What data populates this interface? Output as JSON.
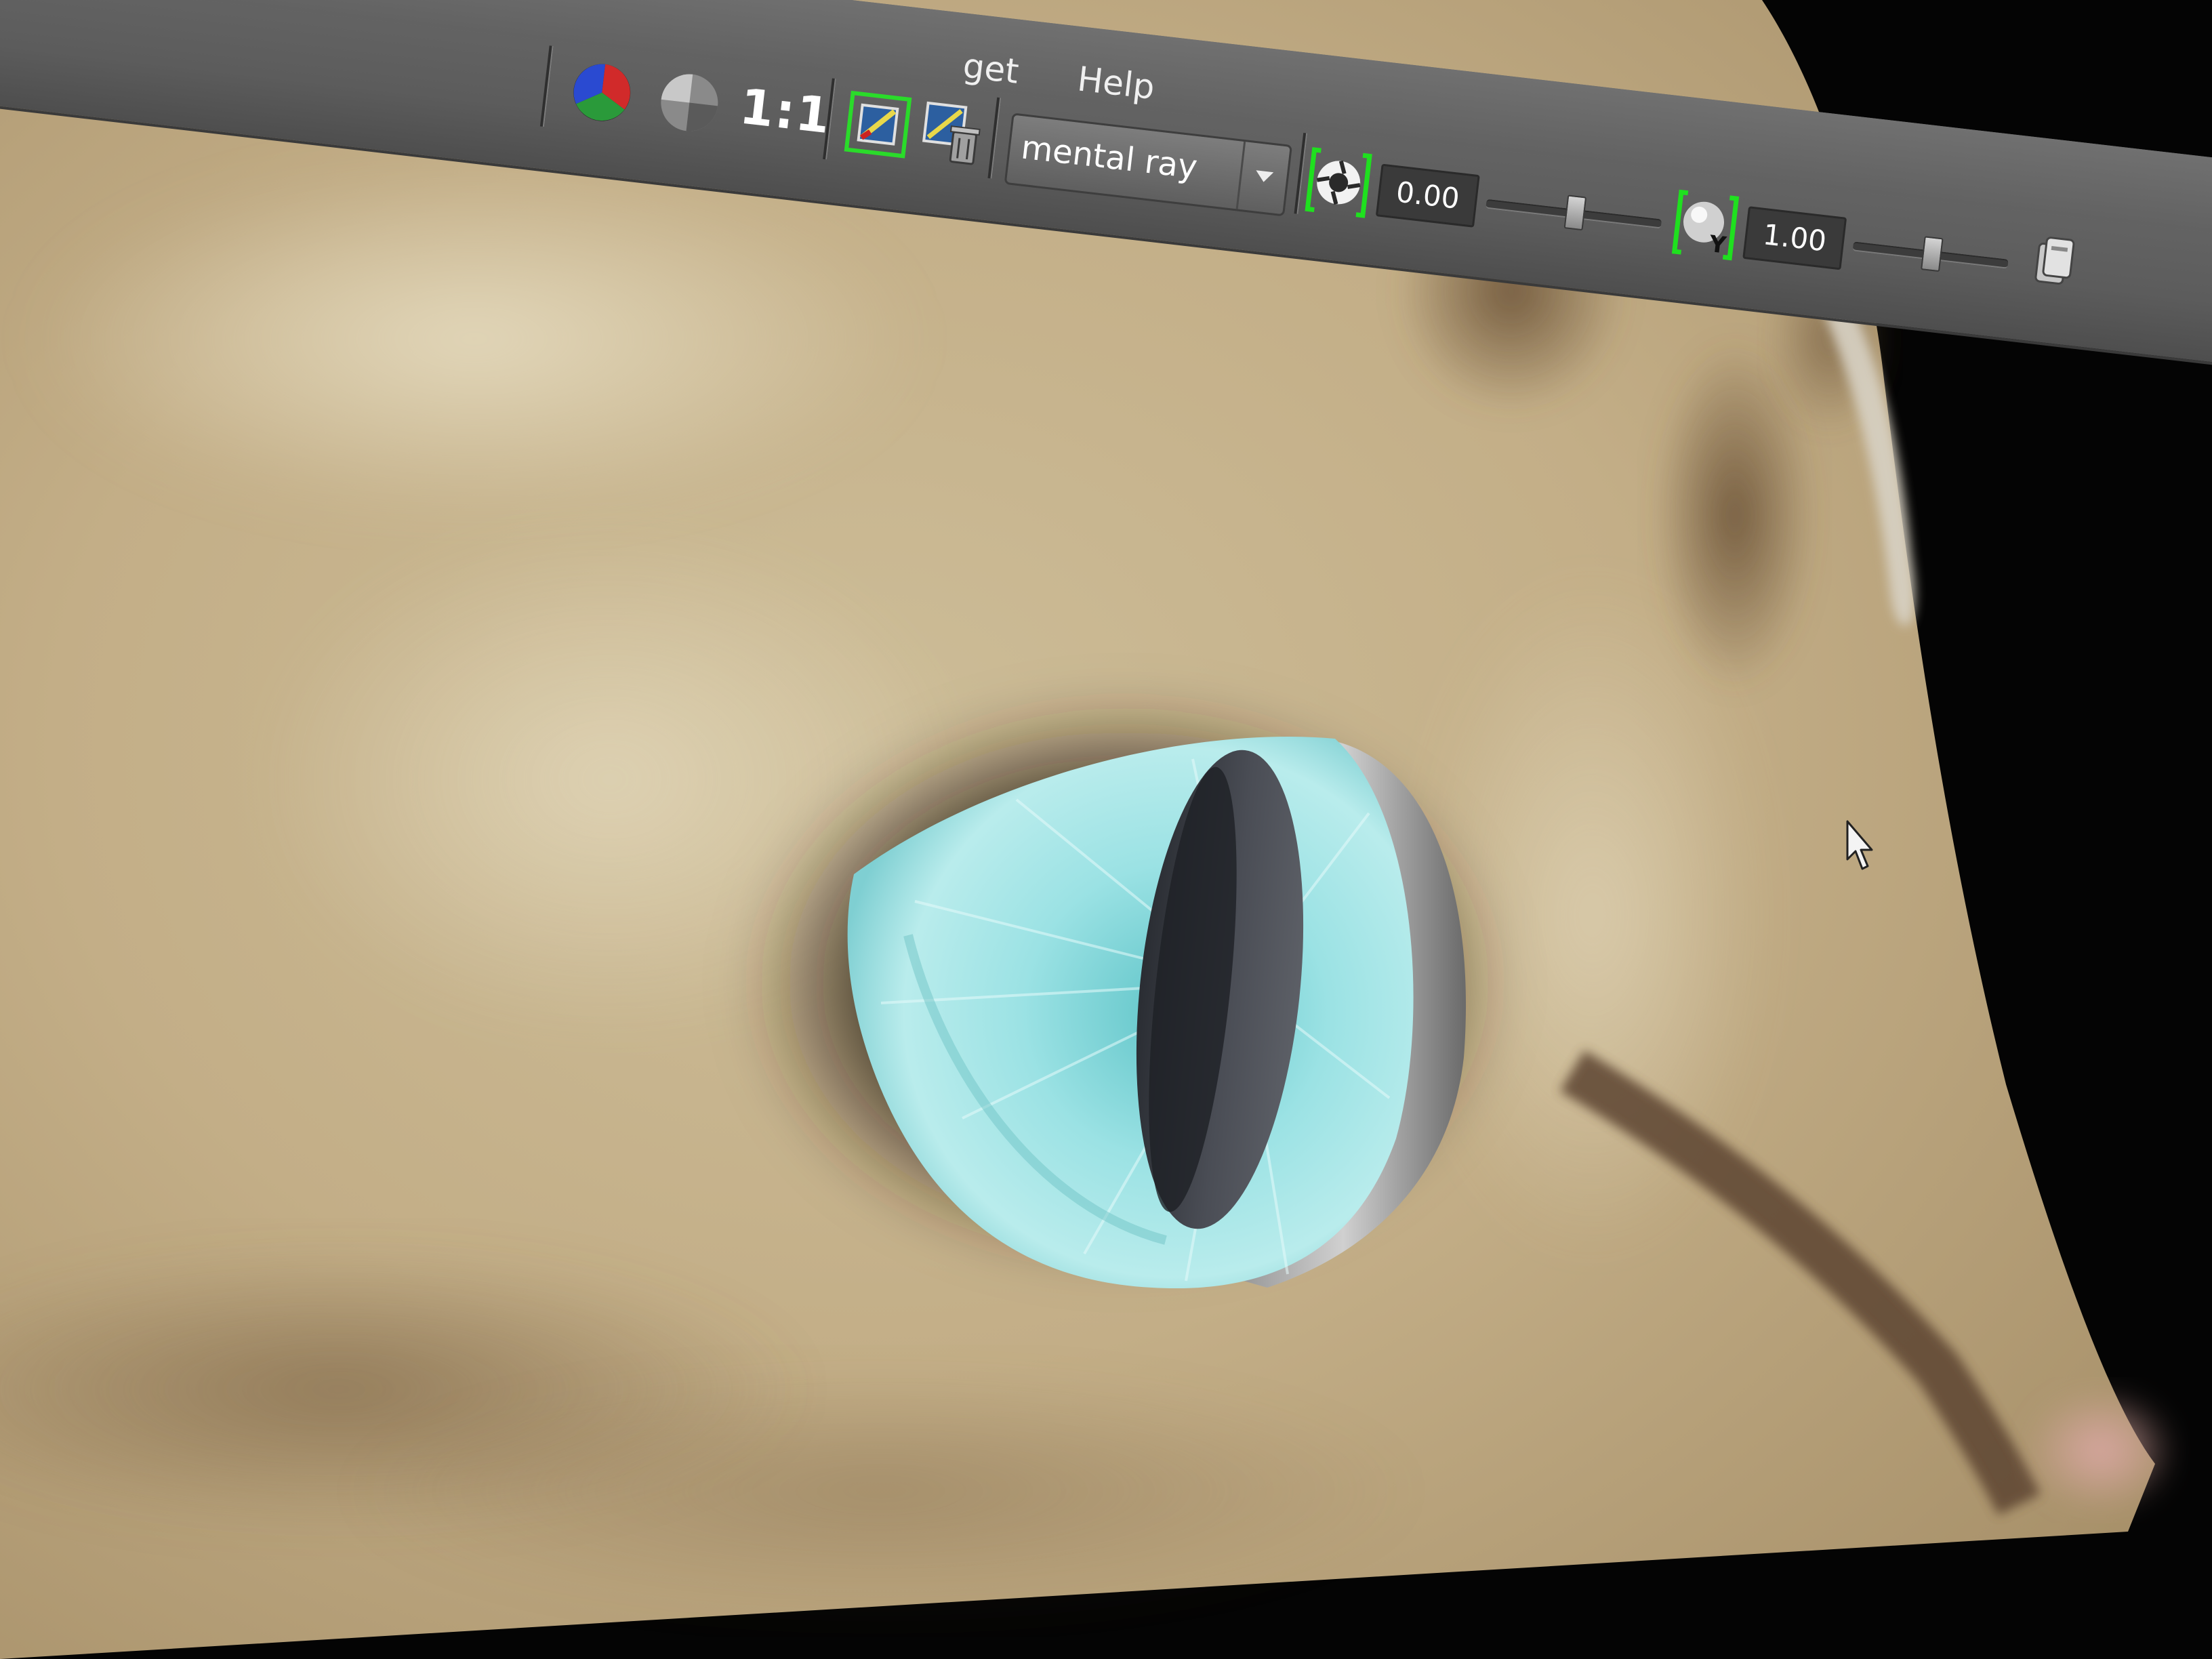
{
  "menubar": {
    "items": [
      {
        "label": "get"
      },
      {
        "label": "Help"
      }
    ]
  },
  "toolbar": {
    "ratio_label": "1:1",
    "renderer": {
      "label": "mental ray"
    },
    "exposure": {
      "value": "0.00",
      "slider_fraction": 0.5
    },
    "gamma": {
      "value": "1.00",
      "slider_fraction": 0.5
    }
  },
  "viewport": {
    "subject": "cat-face-render",
    "iris_color": "#8fd9dc",
    "fur_color": "#c7b48f",
    "background_color": "#050505"
  },
  "icons": [
    "rgb-channels-icon",
    "display-sphere-icon",
    "keep-image-icon",
    "remove-image-icon",
    "exposure-icon",
    "gamma-icon",
    "snapshot-icon",
    "mouse-cursor-icon"
  ]
}
